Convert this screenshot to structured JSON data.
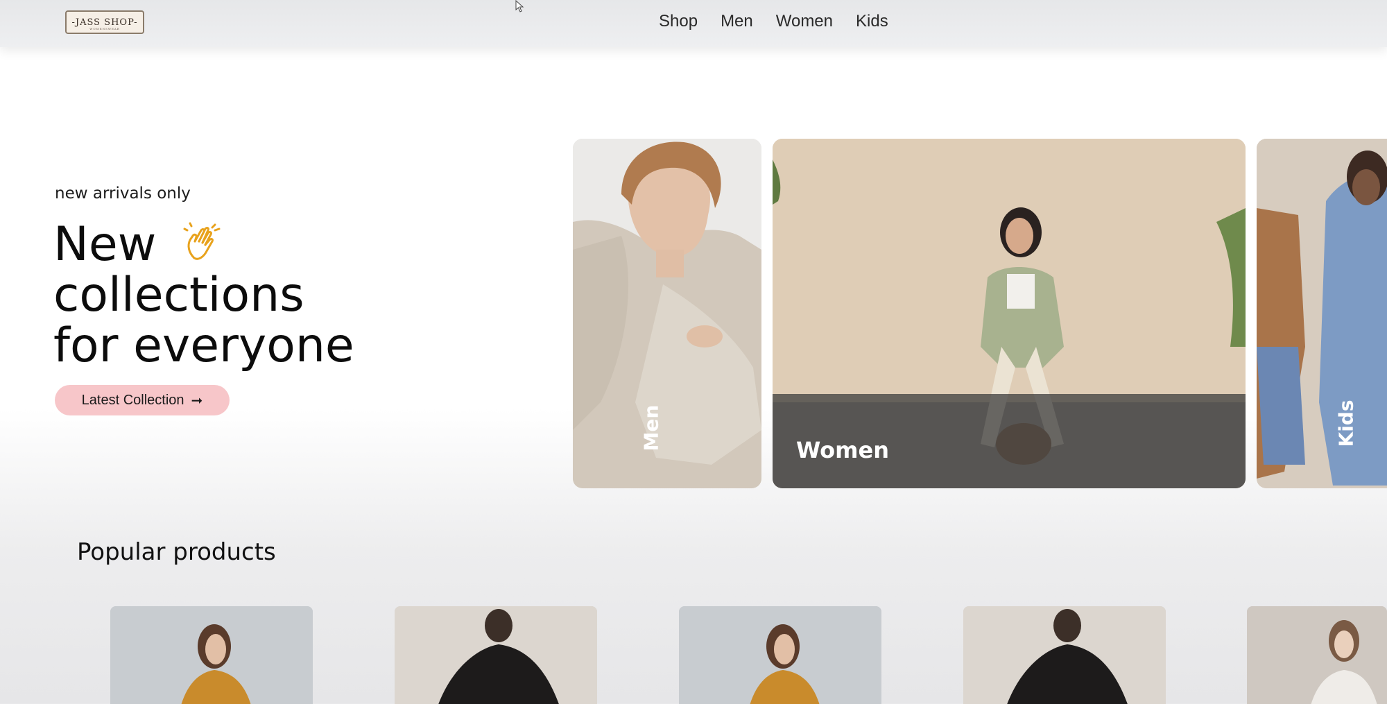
{
  "navbar": {
    "logo_text": "-JASS SHOP-",
    "logo_sub": "WOMENSWEAR",
    "links": [
      "Shop",
      "Men",
      "Women",
      "Kids"
    ]
  },
  "hero": {
    "eyebrow": "new arrivals only",
    "title_lines": [
      "New",
      "collections",
      "for everyone"
    ],
    "cta_label": "Latest Collection",
    "cta_arrow": "➞"
  },
  "categories": {
    "men": "Men",
    "women": "Women",
    "kids": "Kids"
  },
  "popular": {
    "title": "Popular products",
    "items": [
      "product-1",
      "product-2",
      "product-3",
      "product-4",
      "product-5"
    ]
  },
  "colors": {
    "accent_pink": "#f7c6c9",
    "overlay": "#3c3c3c"
  }
}
